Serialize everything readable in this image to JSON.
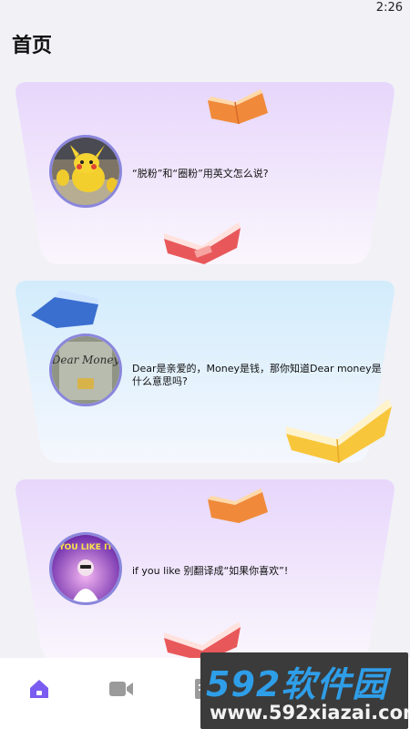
{
  "status_bar": {
    "time": "2:26"
  },
  "page": {
    "title": "首页"
  },
  "cards": [
    {
      "text": "“脱粉”和“圈粉”用英文怎么说?",
      "avatar_icon": "pikachu-photo"
    },
    {
      "text": "Dear是亲爱的，Money是钱，那你知道Dear money是什么意思吗?",
      "avatar_icon": "dear-money-book-photo"
    },
    {
      "text": "if you like 别翻译成“如果你喜欢”!",
      "avatar_icon": "you-like-it-photo"
    }
  ],
  "avatar_texts": {
    "card2": "Dear Money",
    "card3": "YOU LIKE IT"
  },
  "tab_bar": {
    "tabs": [
      {
        "icon": "home-icon",
        "active": true
      },
      {
        "icon": "video-icon",
        "active": false
      },
      {
        "icon": "document-icon",
        "active": false
      },
      {
        "icon": "profile-icon",
        "active": false
      }
    ],
    "active_color": "#7b5cf0",
    "inactive_color": "#9a9a9a"
  },
  "watermark": {
    "title": "592软件园",
    "url": "www.592xiazai.com"
  }
}
